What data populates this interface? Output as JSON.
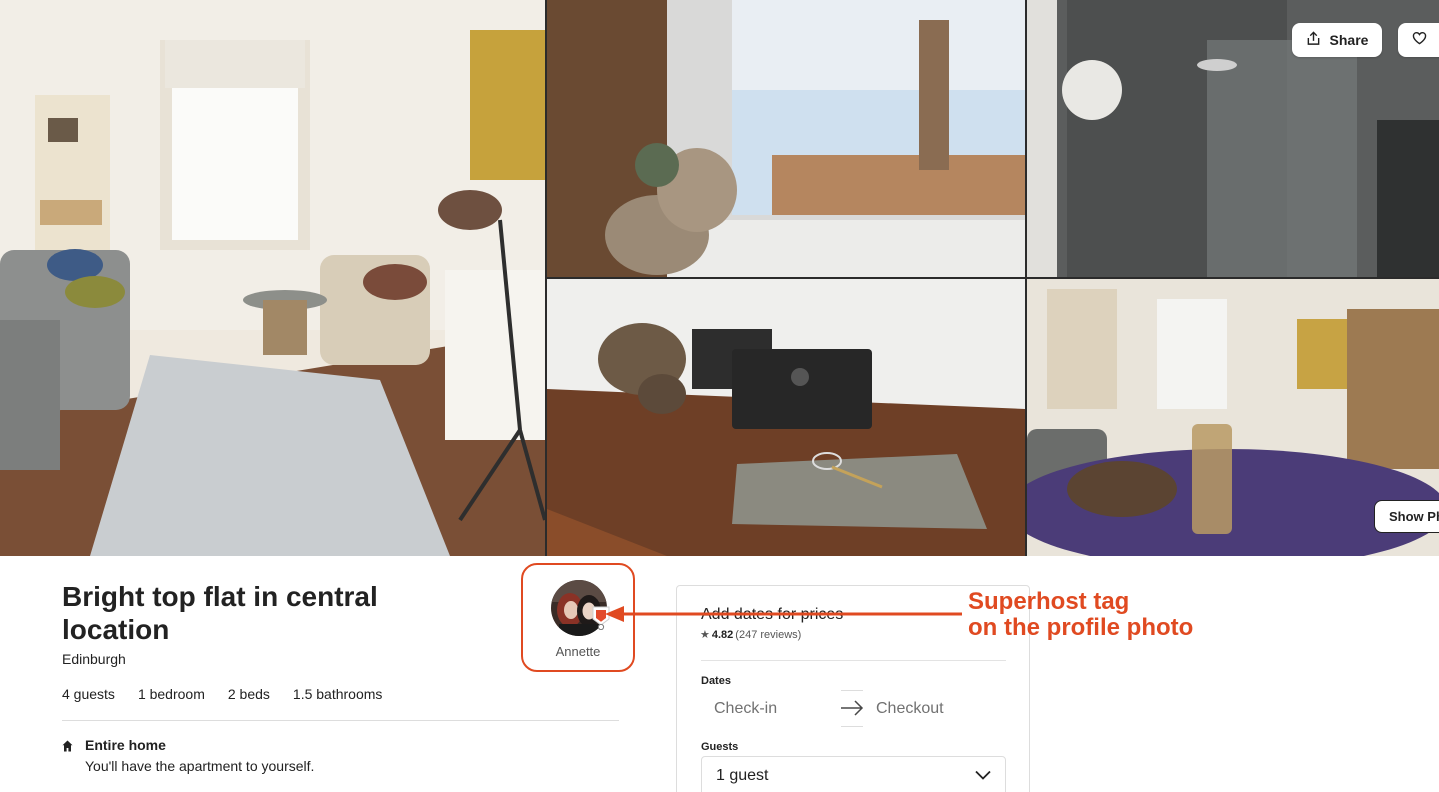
{
  "photos": {
    "main_alt": "living room",
    "count": 5
  },
  "actions": {
    "share_label": "Share",
    "save_icon": "heart-icon",
    "show_photos_label": "Show Photos"
  },
  "listing": {
    "title": "Bright top flat in central location",
    "location": "Edinburgh",
    "facts": [
      "4 guests",
      "1 bedroom",
      "2 beds",
      "1.5 bathrooms"
    ],
    "home_type": {
      "title": "Entire home",
      "description": "You'll have the apartment to yourself."
    }
  },
  "host": {
    "name": "Annette",
    "badge": "superhost"
  },
  "booking": {
    "heading": "Add dates for prices",
    "rating": "4.82",
    "reviews": "(247 reviews)",
    "dates_label": "Dates",
    "checkin_placeholder": "Check-in",
    "checkout_placeholder": "Checkout",
    "guests_label": "Guests",
    "guests_value": "1 guest"
  },
  "annotation": {
    "line1": "Superhost tag",
    "line2": "on the profile photo",
    "color": "#e04a21"
  }
}
